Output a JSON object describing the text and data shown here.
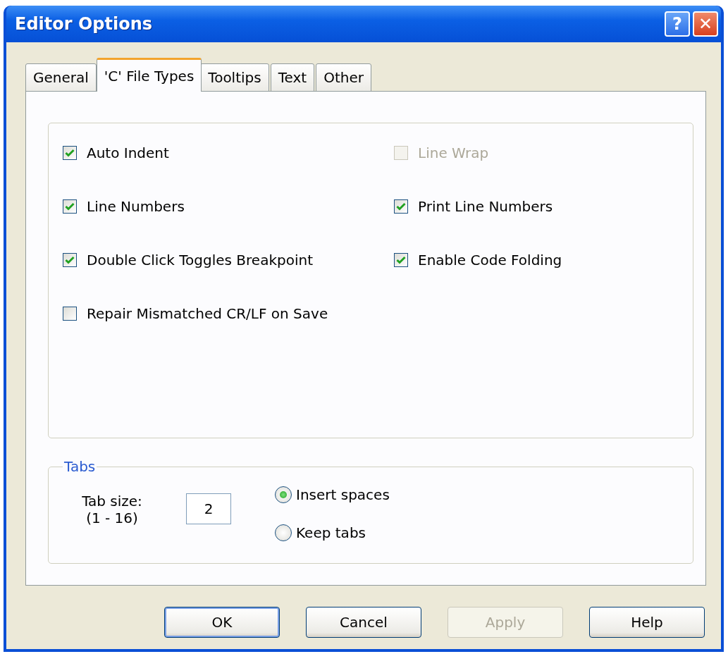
{
  "window": {
    "title": "Editor Options",
    "title_buttons": [
      "?",
      "✕"
    ]
  },
  "tabs": [
    {
      "label": "General",
      "selected": false
    },
    {
      "label": "'C' File Types",
      "selected": true
    },
    {
      "label": "Tooltips",
      "selected": false
    },
    {
      "label": "Text",
      "selected": false
    },
    {
      "label": "Other",
      "selected": false
    }
  ],
  "options": [
    [
      {
        "label": "Auto Indent",
        "checked": true,
        "disabled": false
      },
      {
        "label": "Line Wrap",
        "checked": false,
        "disabled": true
      }
    ],
    [
      {
        "label": "Line Numbers",
        "checked": true,
        "disabled": false
      },
      {
        "label": "Print Line Numbers",
        "checked": true,
        "disabled": false
      }
    ],
    [
      {
        "label": "Double Click Toggles Breakpoint",
        "checked": true,
        "disabled": false
      },
      {
        "label": "Enable Code Folding",
        "checked": true,
        "disabled": false
      }
    ],
    [
      {
        "label": "Repair Mismatched CR/LF on Save",
        "checked": false,
        "disabled": false
      }
    ]
  ],
  "tabs_group": {
    "title": "Tabs",
    "tab_size_label": "Tab size:",
    "tab_size_range": "(1 - 16)",
    "tab_size_value": "2",
    "radios": [
      {
        "label": "Insert spaces",
        "selected": true
      },
      {
        "label": "Keep tabs",
        "selected": false
      }
    ]
  },
  "buttons": [
    {
      "label": "OK",
      "disabled": false,
      "default": true
    },
    {
      "label": "Cancel",
      "disabled": false,
      "default": false
    },
    {
      "label": "Apply",
      "disabled": true,
      "default": false
    },
    {
      "label": "Help",
      "disabled": false,
      "default": false
    }
  ]
}
